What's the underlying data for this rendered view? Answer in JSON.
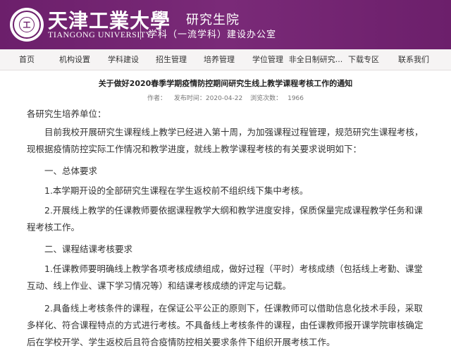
{
  "header": {
    "logo_cn": "天津工業大學",
    "logo_en": "TIANGONG UNIVERSITY",
    "seal_text": "工",
    "dept": "研究生院",
    "subdept": "学科（一流学科）建设办公室"
  },
  "nav": {
    "items": [
      {
        "label": "首页"
      },
      {
        "label": "机构设置"
      },
      {
        "label": "学科建设"
      },
      {
        "label": "招生管理"
      },
      {
        "label": "培养管理"
      },
      {
        "label": "学位管理"
      },
      {
        "label": "非全日制研究..."
      },
      {
        "label": "下载专区"
      },
      {
        "label": "联系我们"
      }
    ]
  },
  "article": {
    "title": "关于做好2020春季学期疫情防控期间研究生线上教学课程考核工作的通知",
    "author_label": "作者：",
    "date": "发布时间：2020-04-22",
    "views_label": "浏览次数：",
    "views": "1966",
    "paragraphs": [
      "各研究生培养单位：",
      "目前我校开展研究生课程线上教学已经进入第十周，为加强课程过程管理，规范研究生课程考核，现根据疫情防控实际工作情况和教学进度，就线上教学课程考核的有关要求说明如下：",
      "一、总体要求",
      "1.本学期开设的全部研究生课程在学生返校前不组织线下集中考核。",
      "2.开展线上教学的任课教师要依据课程教学大纲和教学进度安排，保质保量完成课程教学任务和课程考核工作。",
      "二、课程结课考核要求",
      "1.任课教师要明确线上教学各项考核成绩组成，做好过程（平时）考核成绩（包括线上考勤、课堂互动、线上作业、课下学习情况等）和结课考核成绩的评定与记载。",
      "2.具备线上考核条件的课程，在保证公平公正的原则下，任课教师可以借助信息化技术手段，采取多样化、符合课程特点的方式进行考核。不具备线上考核条件的课程，由任课教师报开课学院审核确定后在学校开学、学生返校后且符合疫情防控相关要求条件下组织开展考核工作。"
    ]
  }
}
